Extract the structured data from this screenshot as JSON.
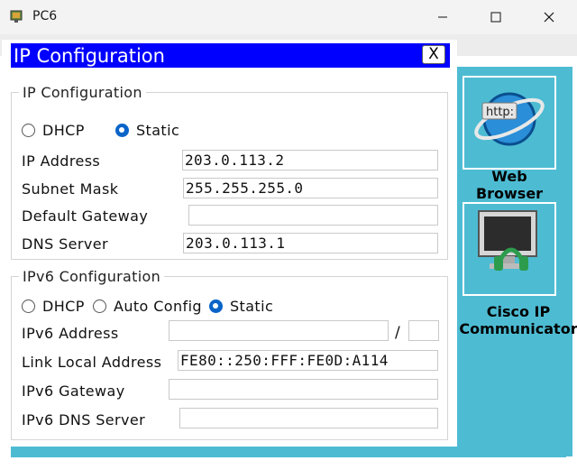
{
  "window": {
    "title": "PC6",
    "close_glyph": "X",
    "controls": [
      "minimize-icon",
      "maximize-icon",
      "close-icon"
    ]
  },
  "desktop": {
    "icons": [
      {
        "label_line1": "Web",
        "label_line2": "Browser",
        "icon": "web-browser-icon",
        "icon_text": "http:"
      },
      {
        "label_line1": "Cisco IP",
        "label_line2": "Communicator",
        "icon": "ip-communicator-icon"
      }
    ]
  },
  "panel": {
    "title": "IP Configuration",
    "ipv4": {
      "legend": "IP Configuration",
      "dhcp_label": "DHCP",
      "static_label": "Static",
      "mode": "Static",
      "ip_address_label": "IP Address",
      "ip_address": "203.0.113.2",
      "subnet_mask_label": "Subnet Mask",
      "subnet_mask": "255.255.255.0",
      "default_gateway_label": "Default Gateway",
      "default_gateway": "",
      "dns_server_label": "DNS Server",
      "dns_server": "203.0.113.1"
    },
    "ipv6": {
      "legend": "IPv6 Configuration",
      "dhcp_label": "DHCP",
      "auto_label": "Auto Config",
      "static_label": "Static",
      "mode": "Static",
      "address_label": "IPv6 Address",
      "address": "",
      "prefix_separator": "/",
      "prefix": "",
      "link_local_label": "Link Local Address",
      "link_local": "FE80::250:FFF:FE0D:A114",
      "gateway_label": "IPv6 Gateway",
      "gateway": "",
      "dns_label": "IPv6 DNS Server",
      "dns": ""
    }
  },
  "colors": {
    "header_bg": "#0000ff",
    "desktop_bg": "#4dbcd3",
    "radio_selected": "#0a64c8"
  }
}
